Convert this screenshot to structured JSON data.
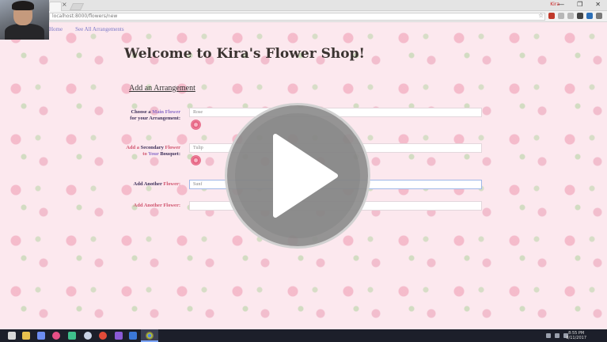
{
  "browser": {
    "url": "localhost:8000/flowers/new",
    "user": "Kira",
    "tab_close": "×",
    "star_icon": "☆",
    "window_controls": [
      "—",
      "❐",
      "✕"
    ]
  },
  "nav": {
    "links": [
      "Home",
      "See All Arrangements"
    ]
  },
  "page": {
    "title": "Welcome to Kira's Flower Shop!",
    "section_title": "Add an Arrangement"
  },
  "form": {
    "main_label": {
      "a": "Choose a",
      "b": "Main Flower",
      "c": "for your",
      "d": "Arrangement:"
    },
    "main_value": "Rose",
    "secondary_label": {
      "a": "Add a",
      "b": "Secondary",
      "c": "Flower to",
      "d": "Your",
      "e": "Bouquet:"
    },
    "secondary_value": "Tulip",
    "another_label": {
      "a": "Add Another",
      "b": "Flower:"
    },
    "another_value": "Sunf",
    "another2_label": "Add Another Flower:",
    "another2_value": ""
  },
  "overlay": {
    "play_icon": "play-icon"
  },
  "taskbar": {
    "time": "8:55 PM",
    "date": "8/11/2017"
  },
  "colors": {
    "accent_pink": "#d0546e",
    "link_purple": "#7a78c8",
    "label_navy": "#3d2f5a"
  }
}
